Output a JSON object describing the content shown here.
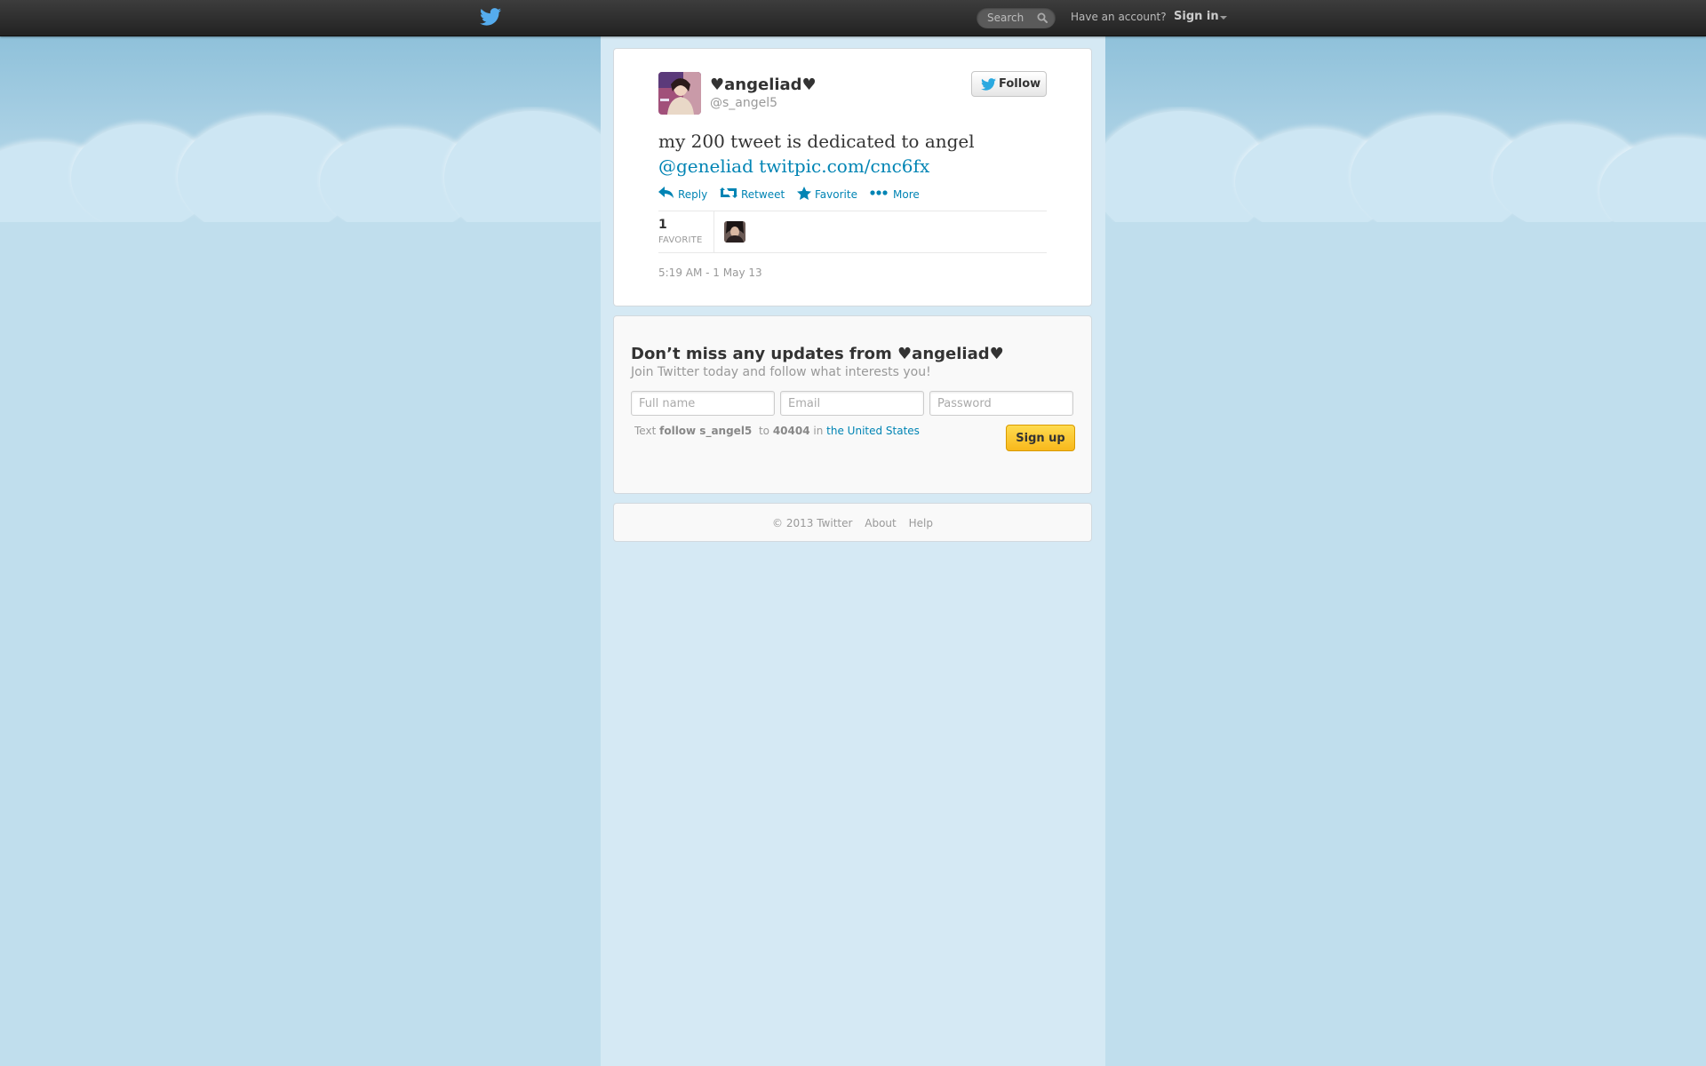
{
  "topbar": {
    "search_placeholder": "Search",
    "have_account": "Have an account?",
    "sign_in": "Sign in"
  },
  "tweet": {
    "display_name": "♥angeliad♥",
    "screen_name": "@s_angel5",
    "follow_label": "Follow",
    "text": "my 200 tweet is dedicated to angel",
    "mention": "@geneliad",
    "link": "twitpic.com/cnc6fx",
    "actions": {
      "reply": "Reply",
      "retweet": "Retweet",
      "favorite": "Favorite",
      "more": "More"
    },
    "favorite_count": "1",
    "favorite_label": "FAVORITE",
    "timestamp": "5:19 AM - 1 May 13"
  },
  "signup": {
    "title": "Don’t miss any updates from ♥angeliad♥",
    "subtitle": "Join Twitter today and follow what interests you!",
    "fullname_placeholder": "Full name",
    "email_placeholder": "Email",
    "password_placeholder": "Password",
    "sms_prefix": "Text",
    "sms_command": "follow s_angel5",
    "sms_to": "to",
    "sms_number": "40404",
    "sms_in": "in",
    "sms_country": "the United States",
    "button_label": "Sign up"
  },
  "footer": {
    "copyright": "© 2013 Twitter",
    "about": "About",
    "help": "Help"
  },
  "colors": {
    "link_blue": "#0084b4",
    "twitter_blue": "#55acee",
    "signup_yellow": "#f8b81c",
    "background_sky": "#c0deed"
  }
}
